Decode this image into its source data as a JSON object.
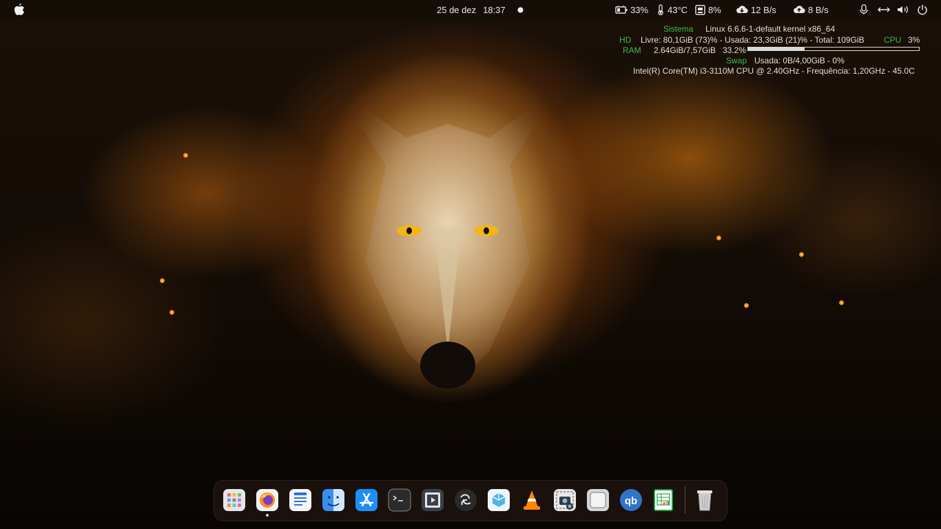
{
  "panel": {
    "date": "25 de dez",
    "time": "18:37",
    "battery": "33%",
    "temperature": "43°C",
    "memory": "8%",
    "download": "12 B/s",
    "upload": "8 B/s",
    "network_speed_icon": "download-cloud-icon",
    "system_icons": [
      "microphone-icon",
      "network-arrows-icon",
      "volume-icon",
      "power-icon"
    ]
  },
  "conky": {
    "sistema_label": "Sistema",
    "kernel": "Linux 6.6.6-1-default kernel x86_64",
    "hd_label": "HD",
    "hd_info": "Livre: 80,1GiB (73)% - Usada: 23,3GiB (21)% - Total: 109GiB",
    "cpu_label": "CPU",
    "cpu_value": "3%",
    "ram_label": "RAM",
    "ram_info": "2.64GiB/7,57GiB",
    "ram_percent": "33.2%",
    "ram_fraction": 0.332,
    "swap_label": "Swap",
    "swap_info": "Usada:  0B/4,00GiB - 0%",
    "cpu_model": "Intel(R) Core(TM) i3-3110M CPU @ 2.40GHz - Frequência: 1,20GHz - 45.0C",
    "label_color": "#3fb950"
  },
  "dock": {
    "apps": [
      {
        "name": "app-grid-icon",
        "running": false
      },
      {
        "name": "firefox-icon",
        "running": true
      },
      {
        "name": "text-editor-icon",
        "running": false
      },
      {
        "name": "file-manager-icon",
        "running": false
      },
      {
        "name": "app-store-icon",
        "running": false
      },
      {
        "name": "terminal-icon",
        "running": false
      },
      {
        "name": "video-player-icon",
        "running": false
      },
      {
        "name": "obs-icon",
        "running": false
      },
      {
        "name": "virtualbox-icon",
        "running": false
      },
      {
        "name": "vlc-icon",
        "running": false
      },
      {
        "name": "screenshot-icon",
        "running": false
      },
      {
        "name": "screen-capture-icon",
        "running": false
      },
      {
        "name": "qbittorrent-icon",
        "running": false
      },
      {
        "name": "spreadsheet-icon",
        "running": false
      },
      {
        "name": "trash-icon",
        "running": false
      }
    ]
  }
}
